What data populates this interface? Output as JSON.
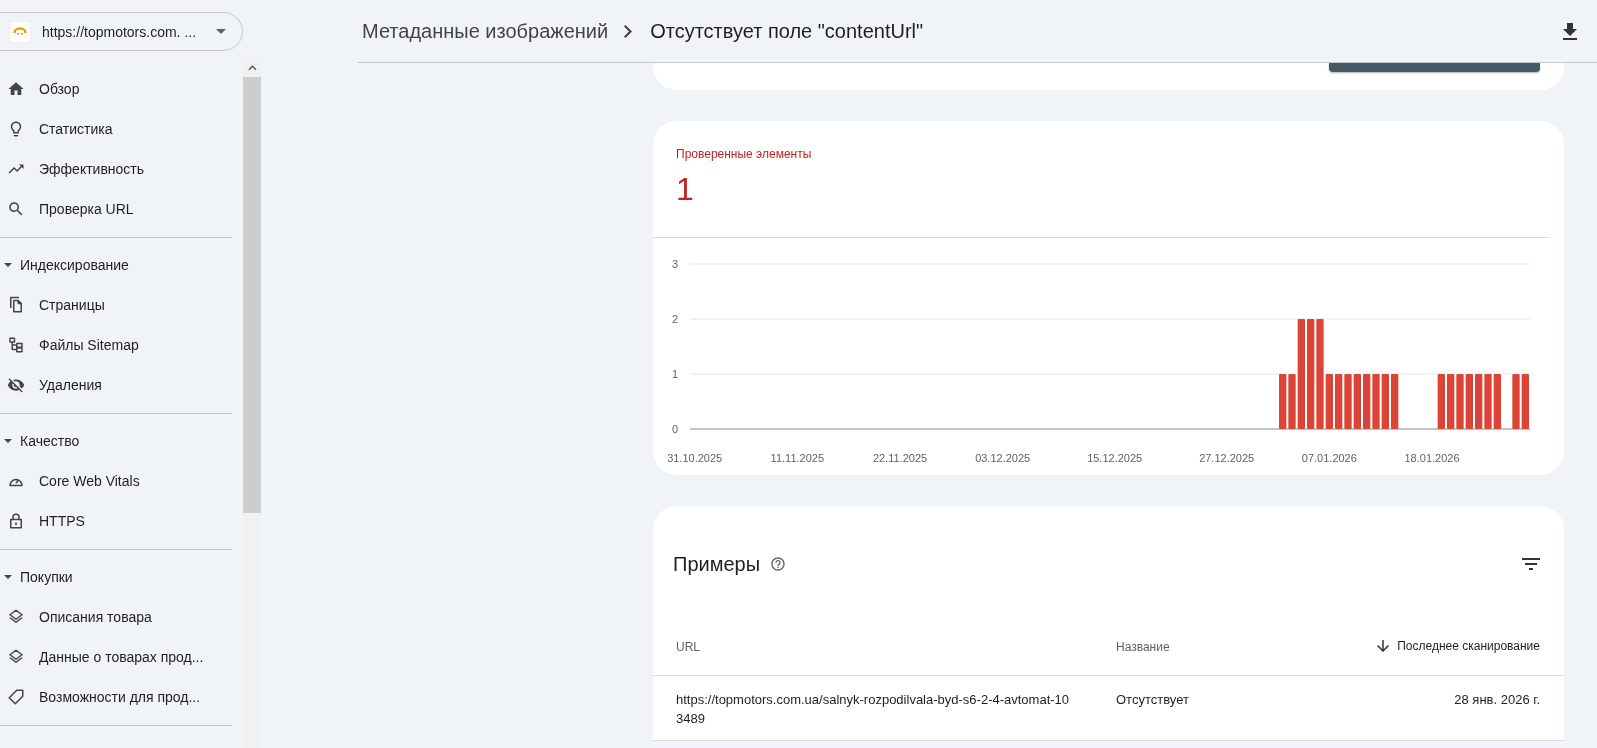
{
  "property": {
    "label": "https://topmotors.com. ..."
  },
  "nav": [
    {
      "items": [
        {
          "label": "Обзор"
        },
        {
          "label": "Статистика"
        },
        {
          "label": "Эффективность"
        },
        {
          "label": "Проверка URL"
        }
      ]
    },
    {
      "title": "Индексирование",
      "expanded": true,
      "items": [
        {
          "label": "Страницы"
        },
        {
          "label": "Файлы Sitemap"
        },
        {
          "label": "Удаления"
        }
      ]
    },
    {
      "title": "Качество",
      "expanded": true,
      "items": [
        {
          "label": "Core Web Vitals"
        },
        {
          "label": "HTTPS"
        }
      ]
    },
    {
      "title": "Покупки",
      "expanded": true,
      "items": [
        {
          "label": "Описания товара"
        },
        {
          "label": "Данные о товарах прод..."
        },
        {
          "label": "Возможности для прод..."
        }
      ]
    }
  ],
  "header": {
    "breadcrumb": [
      {
        "label": "Метаданные изображений"
      },
      {
        "label": "Отсутствует поле \"contentUrl\""
      }
    ]
  },
  "summary": {
    "label": "Проверенные элементы",
    "value": "1",
    "chart_data": {
      "type": "bar",
      "ylim": [
        0,
        3
      ],
      "yticks": [
        0,
        1,
        2,
        3
      ],
      "categories": [
        "31.10.2025",
        null,
        null,
        null,
        null,
        null,
        null,
        null,
        null,
        null,
        null,
        "11.11.2025",
        null,
        null,
        null,
        null,
        null,
        null,
        null,
        null,
        null,
        null,
        "22.11.2025",
        null,
        null,
        null,
        null,
        null,
        null,
        null,
        null,
        null,
        null,
        "03.12.2025",
        null,
        null,
        null,
        null,
        null,
        null,
        null,
        null,
        null,
        null,
        null,
        "15.12.2025",
        null,
        null,
        null,
        null,
        null,
        null,
        null,
        null,
        null,
        null,
        null,
        "27.12.2025",
        null,
        null,
        null,
        null,
        null,
        null,
        null,
        null,
        null,
        null,
        "07.01.2026",
        null,
        null,
        null,
        null,
        null,
        null,
        null,
        null,
        null,
        null,
        "18.01.2026",
        null,
        null,
        null,
        null,
        null,
        null,
        null,
        null,
        null,
        null
      ],
      "series": [
        {
          "color": "#db4437",
          "values": [
            0,
            0,
            0,
            0,
            0,
            0,
            0,
            0,
            0,
            0,
            0,
            0,
            0,
            0,
            0,
            0,
            0,
            0,
            0,
            0,
            0,
            0,
            0,
            0,
            0,
            0,
            0,
            0,
            0,
            0,
            0,
            0,
            0,
            0,
            0,
            0,
            0,
            0,
            0,
            0,
            0,
            0,
            0,
            0,
            0,
            0,
            0,
            0,
            0,
            0,
            0,
            0,
            0,
            0,
            0,
            0,
            0,
            0,
            0,
            0,
            0,
            0,
            0,
            1,
            1,
            2,
            2,
            2,
            1,
            1,
            1,
            1,
            1,
            1,
            1,
            1,
            0,
            0,
            0,
            0,
            1,
            1,
            1,
            1,
            1,
            1,
            1,
            0,
            1,
            1
          ]
        }
      ]
    }
  },
  "examples": {
    "title": "Примеры",
    "columns": [
      {
        "label": "URL",
        "sorted": false
      },
      {
        "label": "Название",
        "sorted": false
      },
      {
        "label": "Последнее сканирование",
        "sorted": true
      }
    ],
    "rows": [
      [
        "https://topmotors.com.ua/salnyk-rozpodilvala-byd-s6-2-4-avtomat-103489",
        "Отсутствует",
        "28 янв. 2026 г."
      ]
    ]
  }
}
